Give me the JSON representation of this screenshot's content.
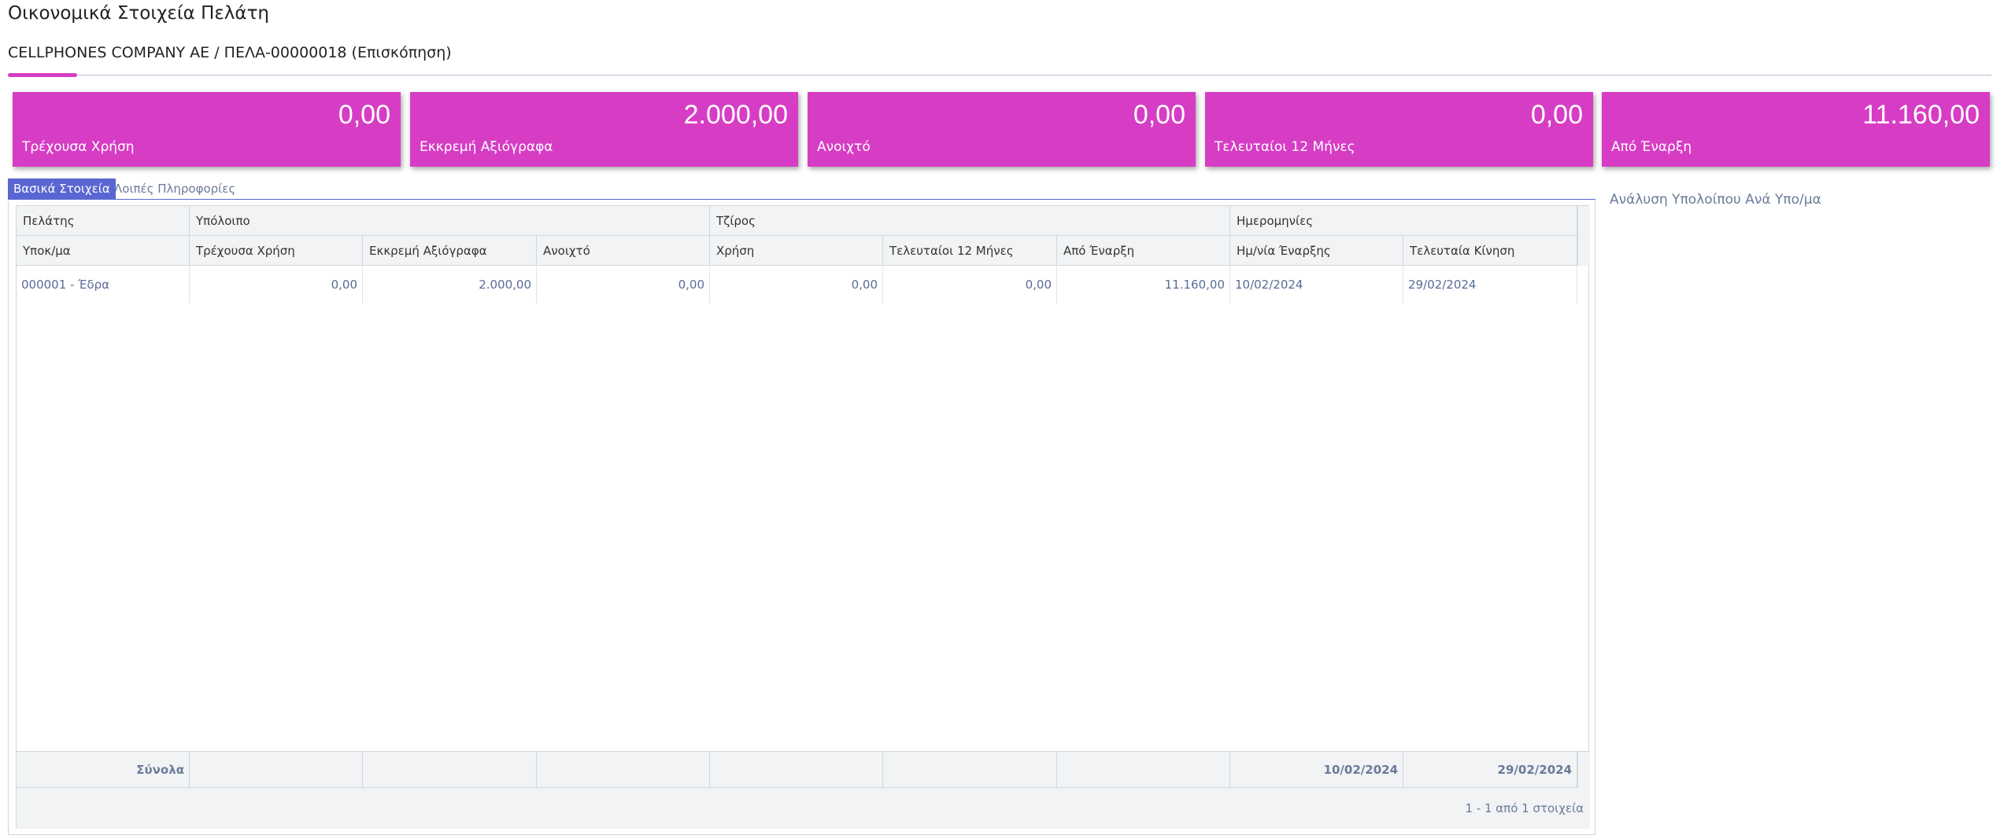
{
  "page": {
    "title": "Οικονομικά Στοιχεία Πελάτη",
    "subtitle": "CELLPHONES COMPANY AE / ΠΕΛΑ-00000018 (Επισκόπηση)"
  },
  "kpis": [
    {
      "value": "0,00",
      "label": "Τρέχουσα Χρήση"
    },
    {
      "value": "2.000,00",
      "label": "Εκκρεμή Αξιόγραφα"
    },
    {
      "value": "0,00",
      "label": "Ανοιχτό"
    },
    {
      "value": "0,00",
      "label": "Τελευταίοι 12 Μήνες"
    },
    {
      "value": "11.160,00",
      "label": "Από Έναρξη"
    }
  ],
  "tabs": {
    "basic": "Βασικά Στοιχεία",
    "other": "Λοιπές Πληροφορίες"
  },
  "side_panel": {
    "title": "Ανάλυση Υπολοίπου Ανά Υπο/μα"
  },
  "grid": {
    "group_headers": {
      "customer": "Πελάτης",
      "balance": "Υπόλοιπο",
      "turnover": "Τζίρος",
      "dates": "Ημερομηνίες"
    },
    "columns": {
      "branch": "Υποκ/μα",
      "current_year": "Τρέχουσα Χρήση",
      "pending_checks": "Εκκρεμή Αξιόγραφα",
      "open": "Ανοιχτό",
      "year": "Χρήση",
      "last12": "Τελευταίοι 12 Μήνες",
      "since_start": "Από Έναρξη",
      "start_date": "Ημ/νία Έναρξης",
      "last_move": "Τελευταία Κίνηση"
    },
    "rows": [
      {
        "branch": "000001 - Έδρα",
        "current_year": "0,00",
        "pending_checks": "2.000,00",
        "open": "0,00",
        "year": "0,00",
        "last12": "0,00",
        "since_start": "11.160,00",
        "start_date": "10/02/2024",
        "last_move": "29/02/2024"
      }
    ],
    "totals": {
      "label": "Σύνολα",
      "start_date": "10/02/2024",
      "last_move": "29/02/2024"
    },
    "pager": "1 - 1 από 1 στοιχεία"
  },
  "colors": {
    "kpi_bg": "#d63dc4",
    "tab_active": "#5a66d1",
    "link_text": "#5a6b96"
  }
}
